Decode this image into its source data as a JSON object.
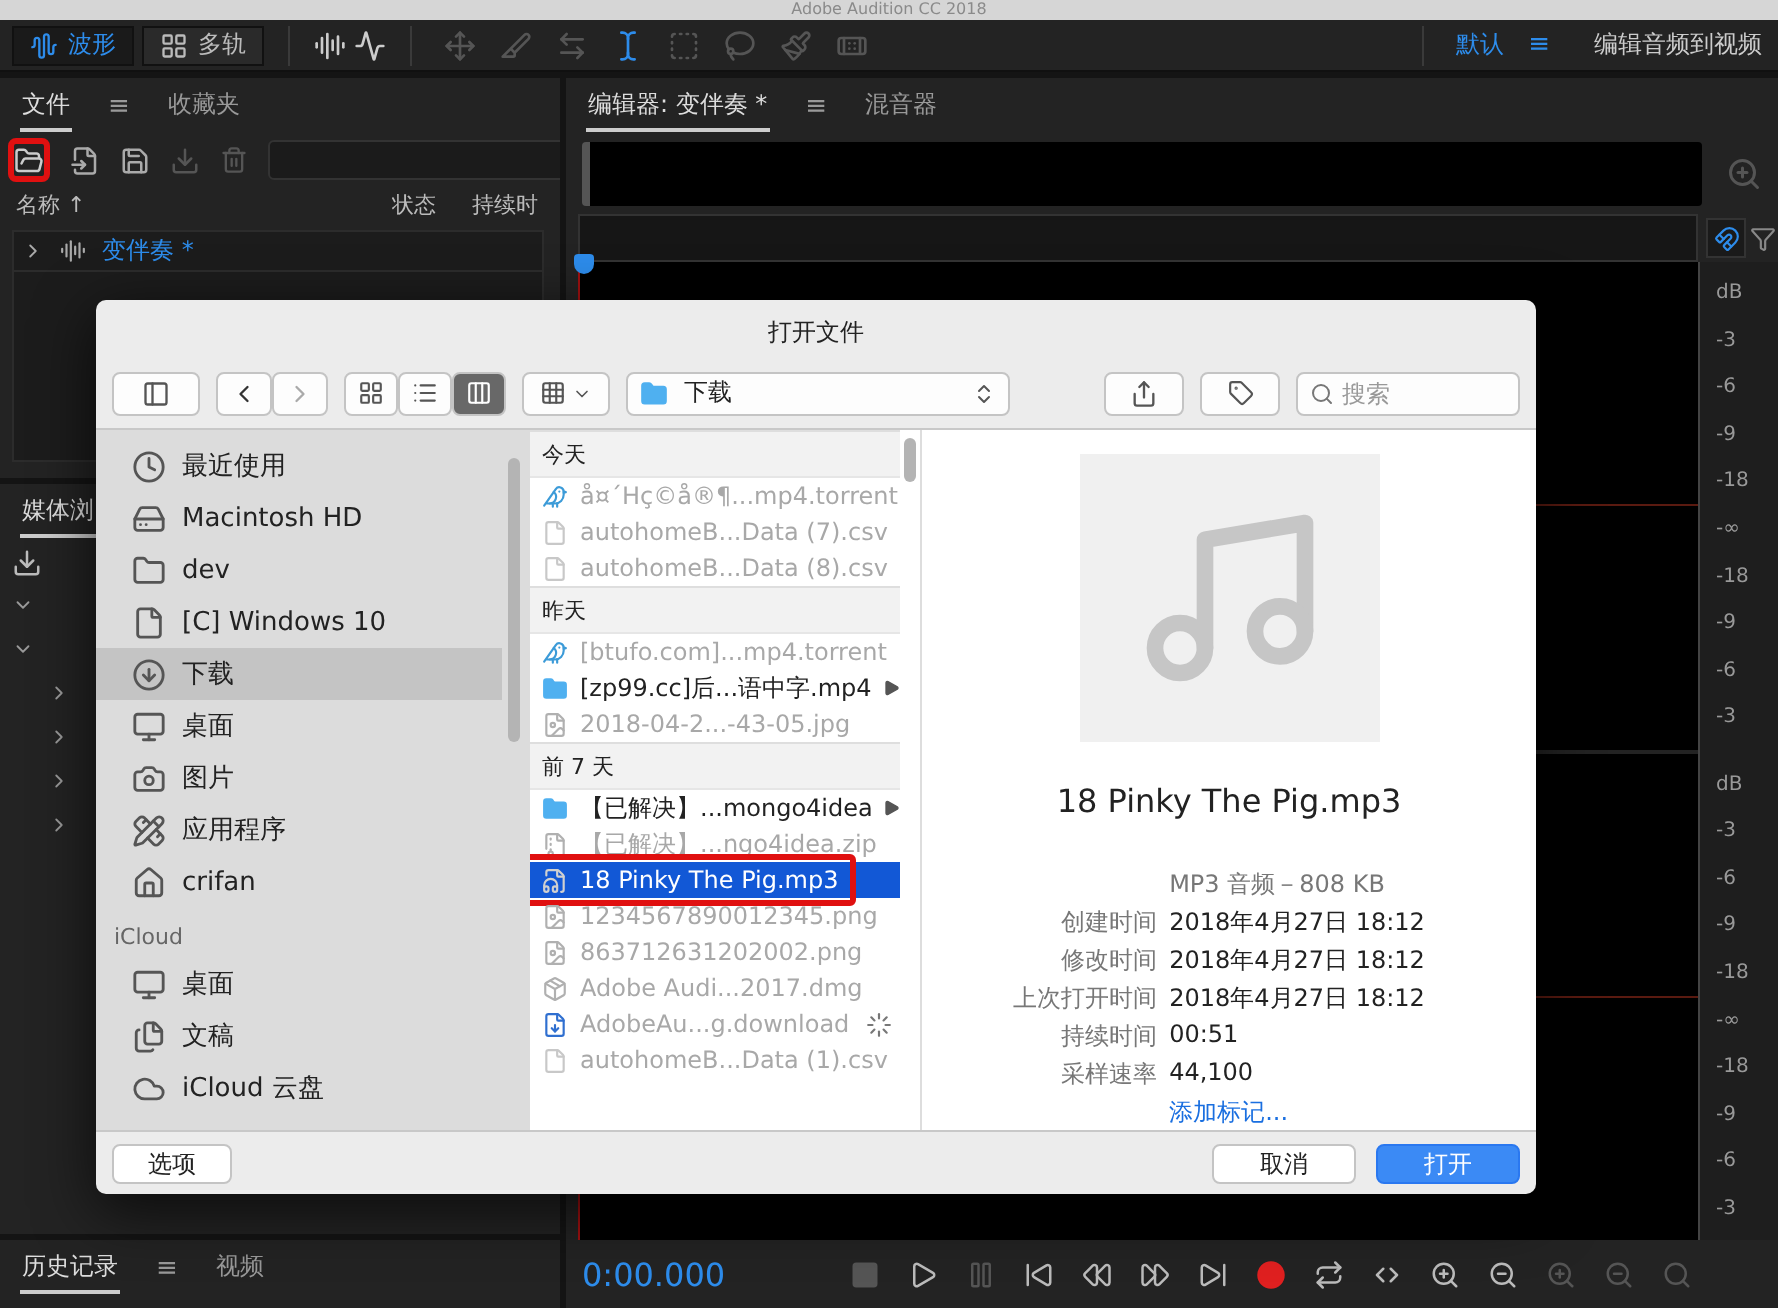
{
  "window": {
    "title": "Adobe Audition CC 2018"
  },
  "workspace_tabs": [
    {
      "label": "波形",
      "selected": true
    },
    {
      "label": "多轨",
      "selected": false
    }
  ],
  "workspace": {
    "name": "默认",
    "menu": "≡",
    "action": "编辑音频到视频"
  },
  "files_panel": {
    "tabs": [
      {
        "label": "文件",
        "selected": true
      },
      {
        "label": "收藏夹",
        "selected": false
      }
    ],
    "menu": "≡",
    "open_highlighted": true,
    "columns": [
      "名称 ↑",
      "状态",
      "持续时"
    ],
    "rows": [
      {
        "name": "变伴奏 *",
        "expanded": false
      }
    ]
  },
  "media_panel": {
    "tab": "媒体浏"
  },
  "history_panel": {
    "tabs": [
      {
        "label": "历史记录",
        "selected": true
      },
      {
        "label": "视频",
        "selected": false
      }
    ],
    "menu": "≡"
  },
  "editor": {
    "tabs": [
      {
        "label": "编辑器: 变伴奏 *",
        "selected": true
      },
      {
        "label": "混音器",
        "selected": false
      }
    ],
    "menu": "≡",
    "channels": [
      {
        "scale": [
          "dB",
          "-3",
          "-6",
          "-9",
          "-18",
          "-∞",
          "-18",
          "-9",
          "-6",
          "-3"
        ]
      },
      {
        "scale": [
          "dB",
          "-3",
          "-6",
          "-9",
          "-18",
          "-∞",
          "-18",
          "-9",
          "-6",
          "-3"
        ]
      }
    ],
    "time": "0:00.000"
  },
  "dialog": {
    "title": "打开文件",
    "view_modes": [
      {
        "kind": "icons",
        "selected": false
      },
      {
        "kind": "list",
        "selected": false
      },
      {
        "kind": "columns",
        "selected": true
      }
    ],
    "location": "下载",
    "search": {
      "placeholder": "搜索"
    },
    "sidebar_groups": [
      {
        "items": [
          {
            "label": "最近使用",
            "kind": "recent",
            "selected": false
          },
          {
            "label": "Macintosh HD",
            "kind": "disk",
            "selected": false
          },
          {
            "label": "dev",
            "kind": "folder",
            "selected": false
          },
          {
            "label": "[C] Windows 10",
            "kind": "document",
            "selected": false
          },
          {
            "label": "下载",
            "kind": "downloads",
            "selected": true
          },
          {
            "label": "桌面",
            "kind": "desktop",
            "selected": false
          },
          {
            "label": "图片",
            "kind": "pictures",
            "selected": false
          },
          {
            "label": "应用程序",
            "kind": "apps",
            "selected": false
          },
          {
            "label": "crifan",
            "kind": "home",
            "selected": false
          }
        ]
      },
      {
        "title": "iCloud",
        "items": [
          {
            "label": "桌面",
            "kind": "desktop",
            "selected": false
          },
          {
            "label": "文稿",
            "kind": "documents",
            "selected": false
          },
          {
            "label": "iCloud 云盘",
            "kind": "cloud",
            "selected": false
          }
        ]
      }
    ],
    "file_groups": [
      {
        "title": "今天",
        "files": [
          {
            "name": "å¤´Hç©å®¶...mp4.torrent",
            "kind": "torrent",
            "disabled": true,
            "selected": false,
            "highlighted": false
          },
          {
            "name": "autohomeB...Data (7).csv",
            "kind": "document",
            "disabled": true,
            "selected": false,
            "highlighted": false
          },
          {
            "name": "autohomeB...Data (8).csv",
            "kind": "document",
            "disabled": true,
            "selected": false,
            "highlighted": false
          }
        ]
      },
      {
        "title": "昨天",
        "files": [
          {
            "name": "[btufo.com]...mp4.torrent",
            "kind": "torrent",
            "disabled": true,
            "selected": false,
            "highlighted": false
          },
          {
            "name": "[zp99.cc]后...语中字.mp4",
            "kind": "folder",
            "disabled": false,
            "selected": false,
            "highlighted": false
          },
          {
            "name": "2018-04-2...-43-05.jpg",
            "kind": "image",
            "disabled": true,
            "selected": false,
            "highlighted": false
          }
        ]
      },
      {
        "title": "前 7 天",
        "files": [
          {
            "name": "【已解决】...mongo4idea",
            "kind": "folder",
            "disabled": false,
            "selected": false,
            "highlighted": false
          },
          {
            "name": "【已解决】...ngo4idea.zip",
            "kind": "zip",
            "disabled": true,
            "selected": false,
            "highlighted": false
          },
          {
            "name": "18 Pinky The Pig.mp3",
            "kind": "audio",
            "disabled": false,
            "selected": true,
            "highlighted": true
          },
          {
            "name": "1234567890012345.png",
            "kind": "image",
            "disabled": true,
            "selected": false,
            "highlighted": false
          },
          {
            "name": "863712631202002.png",
            "kind": "image",
            "disabled": true,
            "selected": false,
            "highlighted": false
          },
          {
            "name": "Adobe Audi...2017.dmg",
            "kind": "dmg",
            "disabled": true,
            "selected": false,
            "highlighted": false
          },
          {
            "name": "AdobeAu...g.download",
            "kind": "download",
            "disabled": true,
            "selected": false,
            "highlighted": false
          },
          {
            "name": "autohomeB...Data (1).csv",
            "kind": "document",
            "disabled": true,
            "selected": false,
            "highlighted": false
          }
        ]
      }
    ],
    "preview": {
      "name": "18 Pinky The Pig.mp3",
      "summary": "MP3 音频－808 KB",
      "fields": [
        {
          "label": "创建时间",
          "value": "2018年4月27日 18:12"
        },
        {
          "label": "修改时间",
          "value": "2018年4月27日 18:12"
        },
        {
          "label": "上次打开时间",
          "value": "2018年4月27日 18:12"
        },
        {
          "label": "持续时间",
          "value": "00:51"
        },
        {
          "label": "采样速率",
          "value": "44,100"
        }
      ],
      "link": "添加标记..."
    },
    "buttons": {
      "options": "选项",
      "cancel": "取消",
      "open": "打开"
    }
  }
}
